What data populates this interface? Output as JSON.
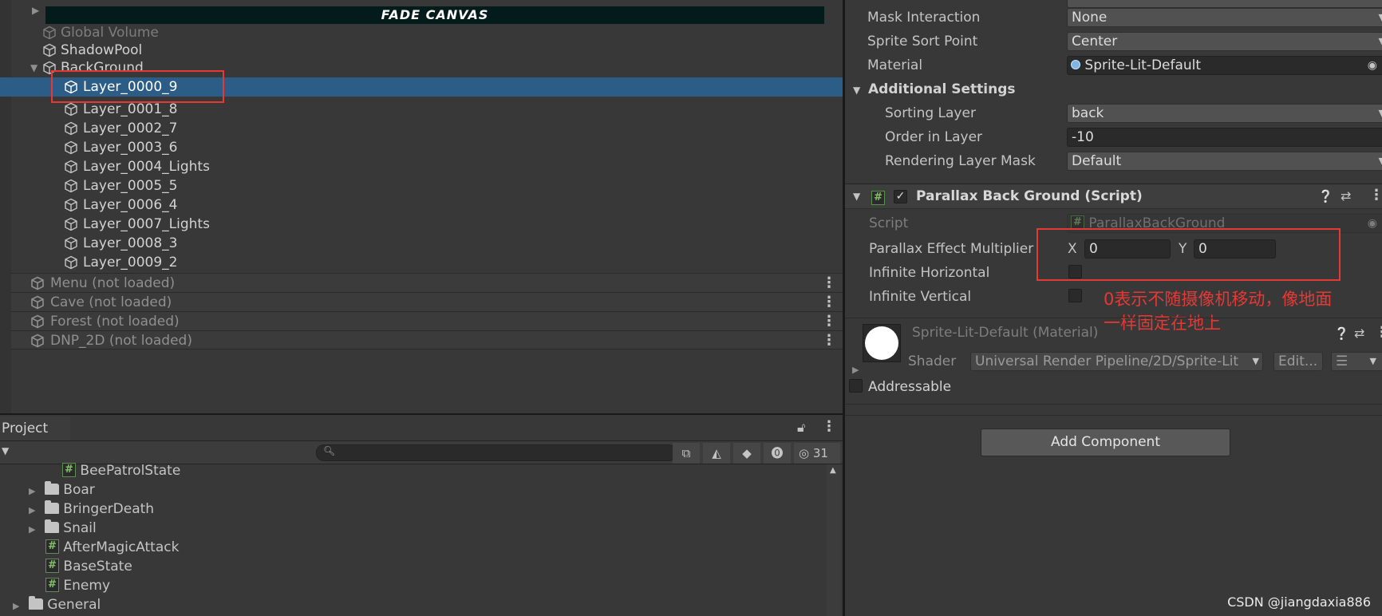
{
  "hierarchy": {
    "fade_canvas": "FADE CANVAS",
    "items": [
      {
        "label": "Global Volume",
        "dim": true
      },
      {
        "label": "ShadowPool",
        "dim": false
      },
      {
        "label": "BackGround",
        "dim": false
      },
      {
        "label": "Layer_0000_9",
        "selected": true
      },
      {
        "label": "Layer_0001_8"
      },
      {
        "label": "Layer_0002_7"
      },
      {
        "label": "Layer_0003_6"
      },
      {
        "label": "Layer_0004_Lights"
      },
      {
        "label": "Layer_0005_5"
      },
      {
        "label": "Layer_0006_4"
      },
      {
        "label": "Layer_0007_Lights"
      },
      {
        "label": "Layer_0008_3"
      },
      {
        "label": "Layer_0009_2"
      }
    ],
    "scenes": [
      "Menu (not loaded)",
      "Cave (not loaded)",
      "Forest (not loaded)",
      "DNP_2D (not loaded)"
    ]
  },
  "project": {
    "tab_label": "Project",
    "hidden_count": "31",
    "items": [
      {
        "label": "BeePatrolState",
        "kind": "script",
        "indent": 2
      },
      {
        "label": "Boar",
        "kind": "folder",
        "indent": 1
      },
      {
        "label": "BringerDeath",
        "kind": "folder",
        "indent": 1
      },
      {
        "label": "Snail",
        "kind": "folder",
        "indent": 1
      },
      {
        "label": "AfterMagicAttack",
        "kind": "script",
        "indent": 1
      },
      {
        "label": "BaseState",
        "kind": "script",
        "indent": 1
      },
      {
        "label": "Enemy",
        "kind": "script",
        "indent": 1
      },
      {
        "label": "General",
        "kind": "folder",
        "indent": 0
      }
    ]
  },
  "inspector": {
    "mask_interaction": {
      "label": "Mask Interaction",
      "value": "None"
    },
    "sprite_sort_point": {
      "label": "Sprite Sort Point",
      "value": "Center"
    },
    "material": {
      "label": "Material",
      "value": "Sprite-Lit-Default"
    },
    "additional_settings": "Additional Settings",
    "sorting_layer": {
      "label": "Sorting Layer",
      "value": "back"
    },
    "order_in_layer": {
      "label": "Order in Layer",
      "value": "-10"
    },
    "rendering_layer_mask": {
      "label": "Rendering Layer Mask",
      "value": "Default"
    },
    "script_component": {
      "title": "Parallax Back Ground (Script)",
      "script_label": "Script",
      "script_value": "ParallaxBackGround",
      "multiplier_label": "Parallax Effect Multiplier",
      "x_label": "X",
      "x_value": "0",
      "y_label": "Y",
      "y_value": "0",
      "infinite_h": "Infinite Horizontal",
      "infinite_v": "Infinite Vertical"
    },
    "annotation_line1": "0表示不随摄像机移动，像地面",
    "annotation_line2": "一样固定在地上",
    "material_block": {
      "title": "Sprite-Lit-Default (Material)",
      "shader_label": "Shader",
      "shader_value": "Universal Render Pipeline/2D/Sprite-Lit",
      "edit_label": "Edit..."
    },
    "addressable": "Addressable",
    "add_component": "Add Component"
  },
  "watermark": "CSDN @jiangdaxia886"
}
